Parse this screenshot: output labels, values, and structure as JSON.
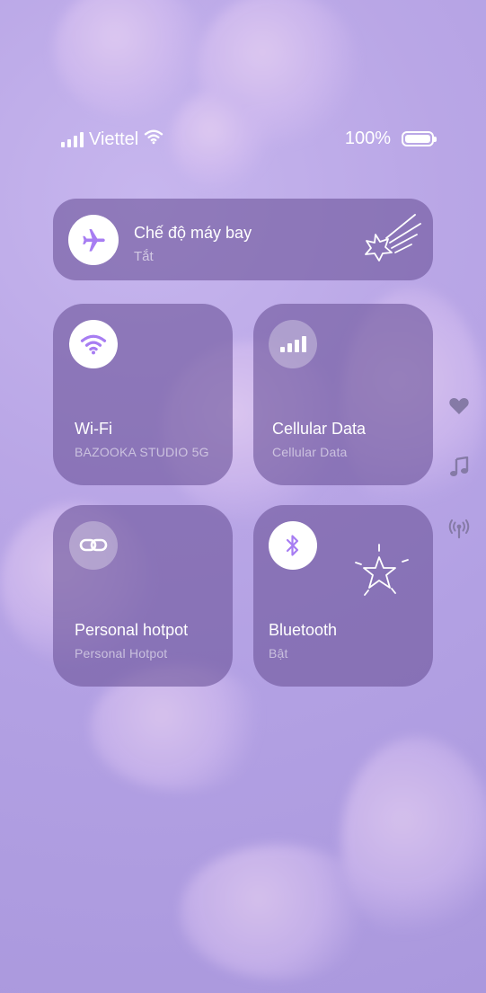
{
  "status_bar": {
    "carrier": "Viettel",
    "battery_percent": "100%"
  },
  "airplane_mode": {
    "title": "Chế độ máy bay",
    "status": "Tắt"
  },
  "tiles": {
    "wifi": {
      "title": "Wi-Fi",
      "subtitle": "BAZOOKA STUDIO 5G"
    },
    "cellular": {
      "title": "Cellular Data",
      "subtitle": "Cellular Data"
    },
    "hotspot": {
      "title": "Personal hotpot",
      "subtitle": "Personal Hotpot"
    },
    "bluetooth": {
      "title": "Bluetooth",
      "subtitle": "Bật"
    }
  },
  "icons": {
    "accent_color": "#a77df2",
    "side": [
      "heart-icon",
      "music-note-icon",
      "broadcast-icon"
    ]
  }
}
